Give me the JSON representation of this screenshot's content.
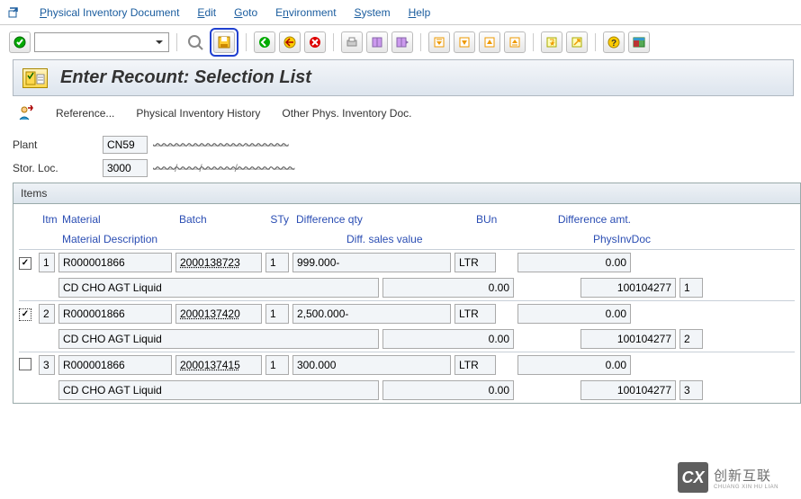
{
  "menu": {
    "items": [
      "Physical Inventory Document",
      "Edit",
      "Goto",
      "Environment",
      "System",
      "Help"
    ],
    "underline_idx": [
      0,
      0,
      0,
      1,
      0,
      0
    ]
  },
  "title": "Enter Recount: Selection List",
  "sub_links": {
    "reference": "Reference...",
    "history": "Physical Inventory History",
    "other": "Other Phys. Inventory Doc."
  },
  "header": {
    "plant_label": "Plant",
    "plant_value": "CN59",
    "plant_desc": "——— ————— ————",
    "stor_label": "Stor. Loc.",
    "stor_value": "3000",
    "stor_desc": "——/——/———/——— ——"
  },
  "items_label": "Items",
  "columns": {
    "itm": "Itm",
    "material": "Material",
    "batch": "Batch",
    "sty": "STy",
    "diff_qty": "Difference qty",
    "bun": "BUn",
    "diff_amt": "Difference amt.",
    "mat_desc": "Material Description",
    "diff_sales": "Diff. sales value",
    "physinv": "PhysInvDoc"
  },
  "rows": [
    {
      "checked": true,
      "dotted": false,
      "itm": "1",
      "material": "R000001866",
      "batch": "2000138723",
      "sty": "1",
      "diff_qty": "999.000-",
      "bun": "LTR",
      "diff_amt": "0.00",
      "mat_desc": "CD CHO AGT Liquid",
      "diff_sales": "0.00",
      "physinv": "100104277",
      "seq": "1"
    },
    {
      "checked": true,
      "dotted": true,
      "itm": "2",
      "material": "R000001866",
      "batch": "2000137420",
      "sty": "1",
      "diff_qty": "2,500.000-",
      "bun": "LTR",
      "diff_amt": "0.00",
      "mat_desc": "CD CHO AGT Liquid",
      "diff_sales": "0.00",
      "physinv": "100104277",
      "seq": "2"
    },
    {
      "checked": false,
      "dotted": false,
      "itm": "3",
      "material": "R000001866",
      "batch": "2000137415",
      "sty": "1",
      "diff_qty": "300.000",
      "bun": "LTR",
      "diff_amt": "0.00",
      "mat_desc": "CD CHO AGT Liquid",
      "diff_sales": "0.00",
      "physinv": "100104277",
      "seq": "3"
    }
  ],
  "watermark": {
    "logo": "CX",
    "text": "创新互联",
    "sub": "CHUANG XIN HU LIAN"
  }
}
